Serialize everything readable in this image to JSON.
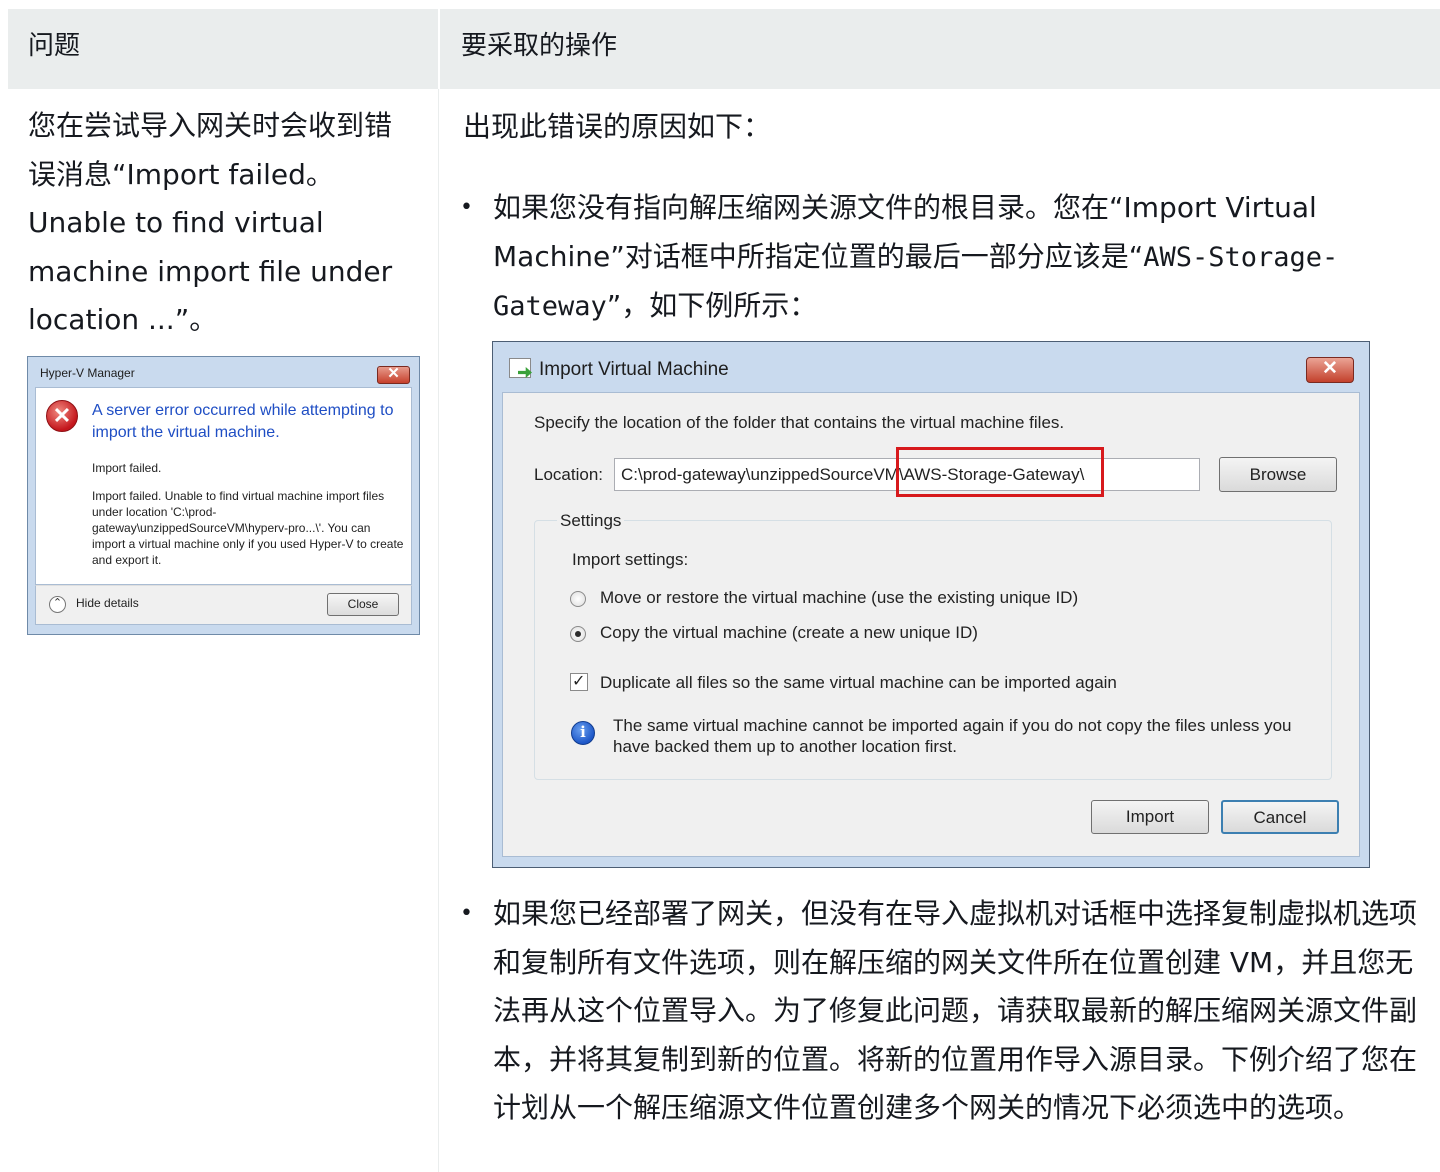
{
  "table": {
    "header": {
      "col1": "问题",
      "col2": "要采取的操作"
    }
  },
  "issue": {
    "text": "您在尝试导入网关时会收到错误消息“Import failed。Unable to find virtual machine import file under location ...”。"
  },
  "hyperv_dialog": {
    "title": "Hyper-V Manager",
    "close_glyph": "✕",
    "error_glyph": "✕",
    "heading": "A server error occurred while attempting to import the virtual machine.",
    "text1": "Import failed.",
    "text2": "Import failed. Unable to find virtual machine import files under location 'C:\\prod-gateway\\unzippedSourceVM\\hyperv-pro...\\'. You can import a virtual machine only if you used Hyper-V to create and export it.",
    "hide_details": "Hide details",
    "close_button": "Close",
    "chevron": "⌃"
  },
  "action": {
    "intro": "出现此错误的原因如下：",
    "bullet_glyph": "•",
    "bullet1_pre": "如果您没有指向解压缩网关源文件的根目录。您在“Import Virtual Machine”对话框中所指定位置的最后一部分应该是“",
    "bullet1_code": "AWS-Storage-Gateway",
    "bullet1_post": "”，如下例所示：",
    "bullet2": "如果您已经部署了网关，但没有在导入虚拟机对话框中选择复制虚拟机选项和复制所有文件选项，则在解压缩的网关文件所在位置创建 VM，并且您无法再从这个位置导入。为了修复此问题，请获取最新的解压缩网关源文件副本，并将其复制到新的位置。将新的位置用作导入源目录。下例介绍了您在计划从一个解压缩源文件位置创建多个网关的情况下必须选中的选项。"
  },
  "import_dialog": {
    "title": "Import Virtual Machine",
    "close_glyph": "✕",
    "specify_text": "Specify the location of the folder that contains the virtual machine files.",
    "location_label": "Location:",
    "location_value": "C:\\prod-gateway\\unzippedSourceVM\\AWS-Storage-Gateway\\",
    "browse_button": "Browse",
    "settings_label": "Settings",
    "import_settings_label": "Import settings:",
    "option_move": "Move or restore the virtual machine (use the existing unique ID)",
    "option_copy": "Copy the virtual machine (create a new unique ID)",
    "option_copy_selected": true,
    "duplicate_label": "Duplicate all files so the same virtual machine can be imported again",
    "duplicate_checked": true,
    "check_glyph": "✓",
    "info_glyph": "i",
    "info_text": "The same virtual machine cannot be imported again if you do not copy the files unless you have backed them up to another location first.",
    "import_button": "Import",
    "cancel_button": "Cancel"
  },
  "colors": {
    "header_bg": "#eaeded",
    "text": "#16191f",
    "highlight_box": "#d7191c",
    "dialog_frame": "#c9daee",
    "error_heading": "#1f4ec4"
  }
}
